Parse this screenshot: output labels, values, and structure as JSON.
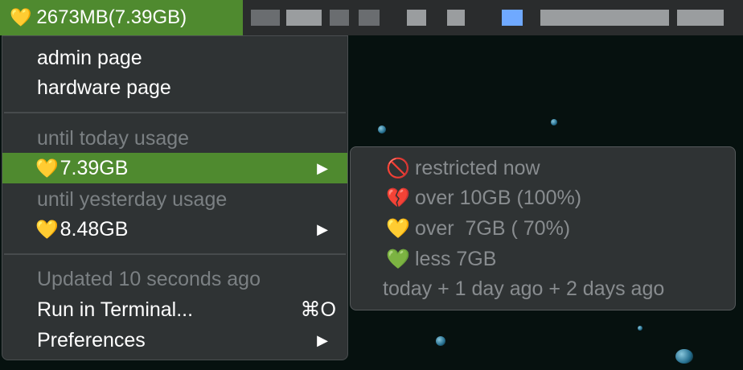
{
  "menubar": {
    "status_icon": "yellow-heart-icon",
    "status_text": "2673MB(7.39GB)",
    "colors": {
      "accent_green": "#4f8a2f",
      "menu_bg": "#2f3334"
    }
  },
  "menu": {
    "admin_page": "admin page",
    "hardware_page": "hardware page",
    "today_header": "until today usage",
    "today_value": "7.39GB",
    "yesterday_header": "until yesterday usage",
    "yesterday_value": "8.48GB",
    "updated": "Updated 10 seconds ago",
    "run_terminal": "Run in Terminal...",
    "run_terminal_shortcut": "⌘O",
    "preferences": "Preferences"
  },
  "submenu": {
    "items": [
      {
        "icon": "no-entry-icon",
        "glyph": "🚫",
        "label": "restricted now"
      },
      {
        "icon": "broken-heart-icon",
        "glyph": "💔",
        "label": "over 10GB (100%)"
      },
      {
        "icon": "yellow-heart-icon",
        "glyph": "💛",
        "label": "over  7GB ( 70%)"
      },
      {
        "icon": "green-heart-icon",
        "glyph": "💚",
        "label": "less 7GB"
      }
    ],
    "footer": "today + 1 day ago + 2 days ago"
  }
}
